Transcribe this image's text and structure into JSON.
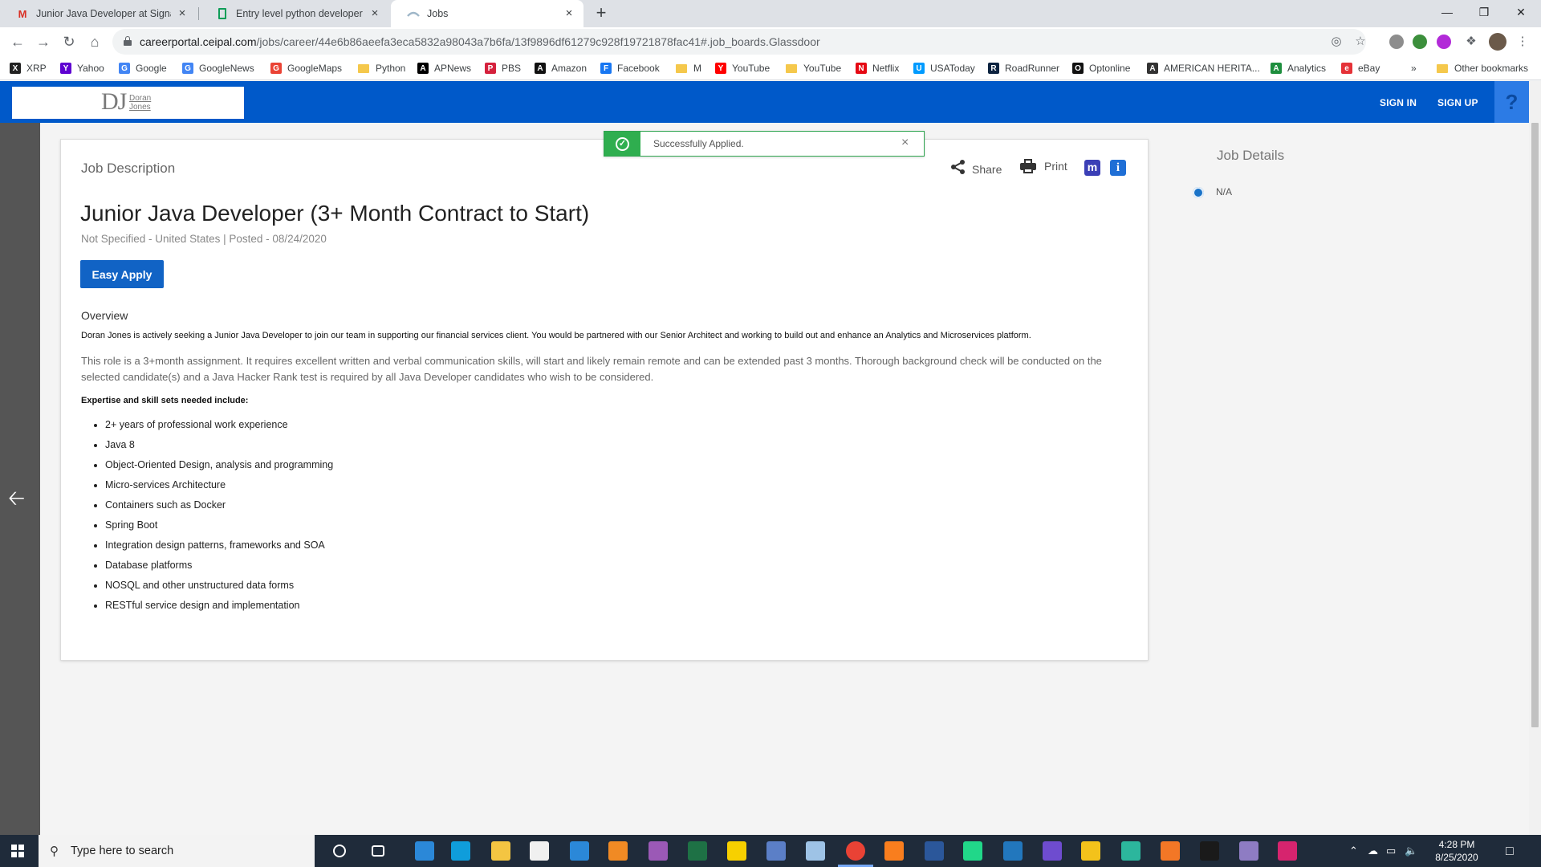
{
  "browser": {
    "tabs": [
      {
        "title": "Junior Java Developer at Signatu",
        "favicon": "gmail-icon",
        "active": false
      },
      {
        "title": "Entry level python developer Job",
        "favicon": "sheets-icon",
        "active": false
      },
      {
        "title": "Jobs",
        "favicon": "ceipal-icon",
        "active": true
      }
    ],
    "new_tab": "+",
    "url_host": "careerportal.ceipal.com",
    "url_path": "/jobs/career/44e6b86aeefa3eca5832a98043a7b6fa/13f9896df61279c928f19721878fac41#.job_boards.Glassdoor",
    "bookmarks": [
      {
        "label": "XRP",
        "icon": "xrp-icon",
        "color": "#222222"
      },
      {
        "label": "Yahoo",
        "icon": "yahoo-icon",
        "color": "#5f01d1"
      },
      {
        "label": "Google",
        "icon": "google-icon",
        "color": "#4285f4"
      },
      {
        "label": "GoogleNews",
        "icon": "googlenews-icon",
        "color": "#4285f4"
      },
      {
        "label": "GoogleMaps",
        "icon": "googlemaps-icon",
        "color": "#ea4335"
      },
      {
        "label": "Python",
        "icon": "folder-icon",
        "color": "#f5c84c"
      },
      {
        "label": "APNews",
        "icon": "apnews-icon",
        "color": "#000000"
      },
      {
        "label": "PBS",
        "icon": "pbs-icon",
        "color": "#d5213d"
      },
      {
        "label": "Amazon",
        "icon": "amazon-icon",
        "color": "#111111"
      },
      {
        "label": "Facebook",
        "icon": "facebook-icon",
        "color": "#1877f2"
      },
      {
        "label": "M",
        "icon": "folder-icon",
        "color": "#f5c84c"
      },
      {
        "label": "YouTube",
        "icon": "youtube-icon",
        "color": "#ff0000"
      },
      {
        "label": "YouTube",
        "icon": "folder-icon",
        "color": "#f5c84c"
      },
      {
        "label": "Netflix",
        "icon": "netflix-icon",
        "color": "#e50914"
      },
      {
        "label": "USAToday",
        "icon": "usatoday-icon",
        "color": "#009bff"
      },
      {
        "label": "RoadRunner",
        "icon": "roadrunner-icon",
        "color": "#0c2340"
      },
      {
        "label": "Optonline",
        "icon": "optonline-icon",
        "color": "#111111"
      },
      {
        "label": "AMERICAN HERITA...",
        "icon": "americanheritage-icon",
        "color": "#333333"
      },
      {
        "label": "Analytics",
        "icon": "analytics-icon",
        "color": "#1e8e3e"
      },
      {
        "label": "eBay",
        "icon": "ebay-icon",
        "color": "#e53238"
      }
    ],
    "overflow": "»",
    "other_bookmarks": "Other bookmarks"
  },
  "site": {
    "logo_mark": "DJ",
    "logo_line1": "Doran",
    "logo_line2": "Jones",
    "sign_in": "SIGN IN",
    "sign_up": "SIGN UP",
    "help": "?"
  },
  "toast": {
    "message": "Successfully Applied.",
    "icon": "check-circle-icon",
    "close": "×",
    "color": "#2fae4f"
  },
  "job": {
    "section_title": "Job Description",
    "share": "Share",
    "print": "Print",
    "badge_m": "m",
    "badge_i": "i",
    "title": "Junior Java Developer (3+ Month Contract to Start)",
    "meta": "Not Specified - United States | Posted - 08/24/2020",
    "apply_button": "Easy Apply",
    "overview_heading": "Overview",
    "paragraph1": "Doran Jones is actively seeking a Junior Java Developer to join our team in supporting our financial services client.   You would be partnered with our Senior Architect and working to build out and enhance an Analytics and Microservices platform.",
    "paragraph2": "This role is a 3+month assignment.  It requires excellent written and verbal communication skills, will start and likely remain remote and can be extended past 3 months.  Thorough background check will be conducted on the selected candidate(s) and a Java Hacker Rank test is required by all Java Developer candidates who wish to be considered.",
    "skills_heading": "Expertise and skill sets needed include:",
    "skills": [
      "2+ years of professional work experience",
      "Java 8",
      "Object-Oriented Design, analysis and programming",
      "Micro-services Architecture",
      "Containers such as Docker",
      "Spring Boot",
      "Integration design patterns, frameworks and SOA",
      "Database platforms",
      "NOSQL and other unstructured data forms",
      "RESTful service design and implementation"
    ]
  },
  "details": {
    "title": "Job Details",
    "value": "N/A"
  },
  "taskbar": {
    "search_placeholder": "Type here to search",
    "time": "4:28 PM",
    "date": "8/25/2020"
  },
  "colors": {
    "brand_blue": "#0059c9",
    "apply_blue": "#1163c5"
  }
}
